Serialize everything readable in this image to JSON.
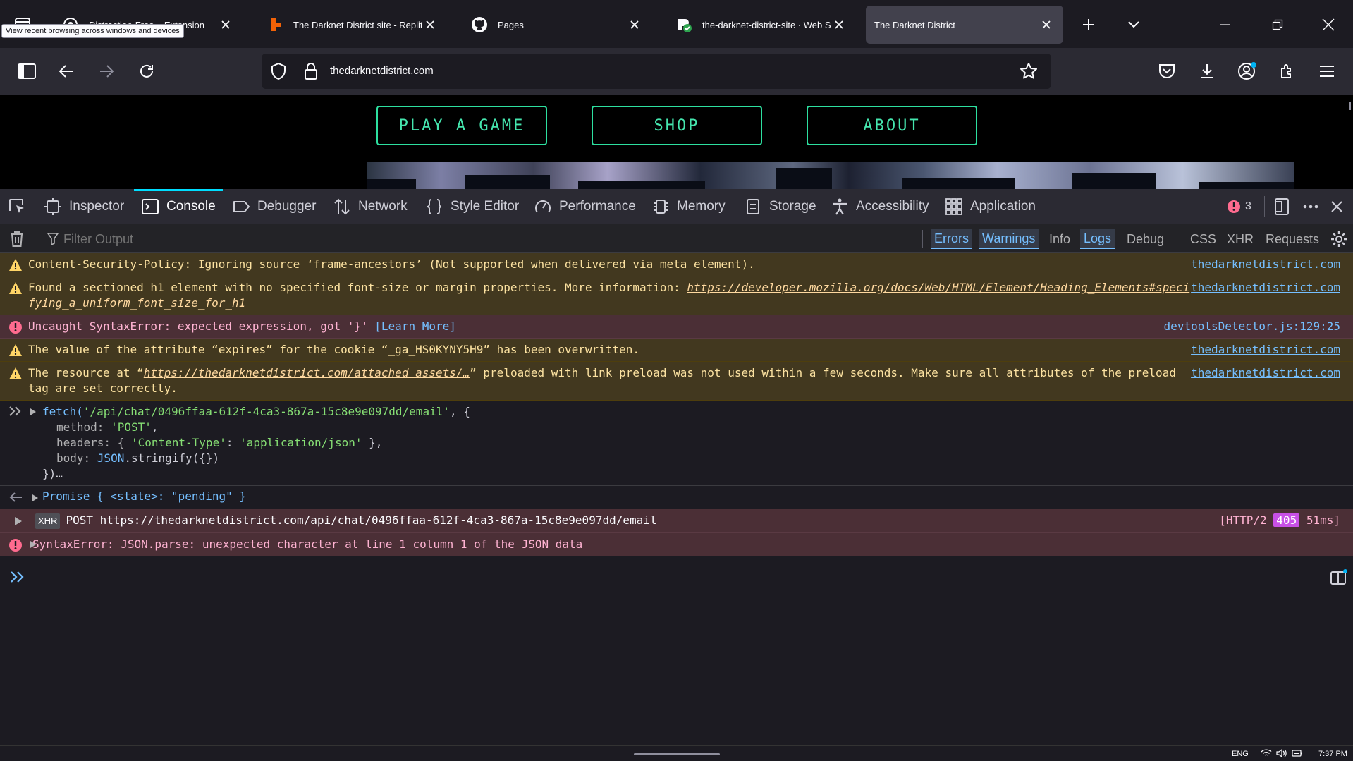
{
  "tabs": [
    {
      "title": "Distraction-Free... Extension",
      "icon": "privacy-icon"
    },
    {
      "title": "The Darknet District site - Replit",
      "icon": "replit-icon"
    },
    {
      "title": "Pages",
      "icon": "github-icon"
    },
    {
      "title": "the-darknet-district-site · Web Servi",
      "icon": "render-icon"
    },
    {
      "title": "The Darknet District",
      "icon": "none",
      "selected": true
    }
  ],
  "tooltip": "View recent browsing across windows and devices",
  "url": "thedarknetdistrict.com",
  "site": {
    "buttons": [
      "PLAY A GAME",
      "SHOP",
      "ABOUT"
    ],
    "accent": "#2ddf9f"
  },
  "devtools": {
    "tabs": [
      "Inspector",
      "Console",
      "Debugger",
      "Network",
      "Style Editor",
      "Performance",
      "Memory",
      "Storage",
      "Accessibility",
      "Application"
    ],
    "error_count": "3",
    "filter_placeholder": "Filter Output",
    "filters": [
      "Errors",
      "Warnings",
      "Info",
      "Logs",
      "Debug",
      "CSS",
      "XHR",
      "Requests"
    ]
  },
  "messages": [
    {
      "level": "warning",
      "text": "Content-Security-Policy: Ignoring source ‘frame-ancestors’ (Not supported when delivered via meta element).",
      "source": "thedarknetdistrict.com"
    },
    {
      "level": "warning",
      "text_a": "Found a sectioned h1 element with no specified font-size or margin properties. More information: ",
      "link": "https://developer.mozilla.org/docs/Web/HTML/Element/Heading_Elements#specifying_a_uniform_font_size_for_h1",
      "source": "thedarknetdistrict.com"
    },
    {
      "level": "error",
      "text": "Uncaught SyntaxError: expected expression, got '}'",
      "learn_more": "[Learn More]",
      "source": "devtoolsDetector.js:129:25"
    },
    {
      "level": "warning",
      "text": "The value of the attribute “expires” for the cookie “_ga_HS0KYNY5H9” has been overwritten.",
      "source": "thedarknetdistrict.com"
    },
    {
      "level": "warning",
      "text_a": "The resource at “",
      "link": "https://thedarknetdistrict.com/attached_assets/…",
      "text_b": "” preloaded with link preload was not used within a few seconds. Make sure all attributes of the preload tag are set correctly.",
      "source": "thedarknetdistrict.com"
    }
  ],
  "input": {
    "line1_fn": "fetch(",
    "line1_str": "'/api/chat/0496ffaa-612f-4ca3-867a-15c8e9e097dd/email'",
    "line1_end": ", {",
    "line2_key": "method: ",
    "line2_val": "'POST'",
    "line2_end": ",",
    "line3_key": "headers: { ",
    "line3_k2": "'Content-Type'",
    "line3_colon": ": ",
    "line3_v2": "'application/json'",
    "line3_end": " },",
    "line4_key": "body: ",
    "line4_js": "JSON",
    "line4_rest": ".stringify({})",
    "line5": "})…"
  },
  "output": {
    "promise": "Promise { <state>: \"pending\" }"
  },
  "xhr": {
    "badge": "XHR",
    "method": "POST",
    "url": "https://thedarknetdistrict.com/api/chat/0496ffaa-612f-4ca3-867a-15c8e9e097dd/email",
    "proto": "[HTTP/2 ",
    "status": "405",
    "time": " 51ms]"
  },
  "final_error": "SyntaxError: JSON.parse: unexpected character at line 1 column 1 of the JSON data",
  "taskbar": {
    "lang": "ENG",
    "time": "7:37 PM"
  }
}
